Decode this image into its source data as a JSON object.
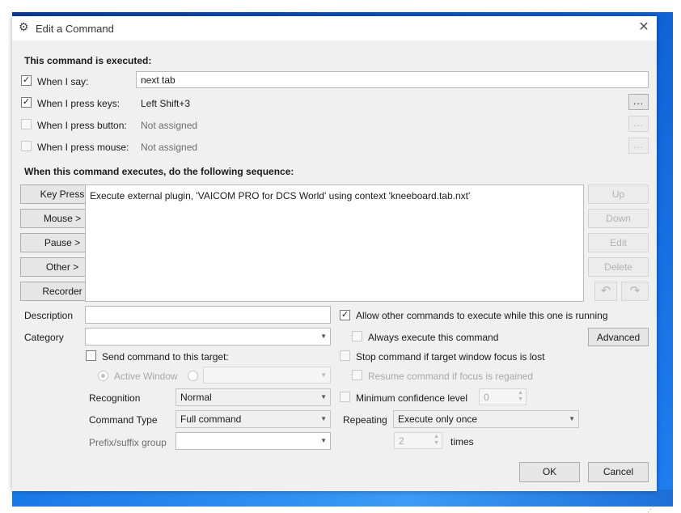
{
  "window": {
    "title": "Edit a Command",
    "icon": "gear-icon",
    "close_glyph": "✕"
  },
  "triggers": {
    "heading": "This command is executed:",
    "when_i_say": {
      "label": "When I say:",
      "checked": true,
      "value": "next tab"
    },
    "when_i_press_keys": {
      "label": "When I press keys:",
      "checked": true,
      "value": "Left Shift+3",
      "button": "..."
    },
    "when_i_press_button": {
      "label": "When I press button:",
      "checked": false,
      "value": "Not assigned",
      "button": "..."
    },
    "when_i_press_mouse": {
      "label": "When I press mouse:",
      "checked": false,
      "value": "Not assigned",
      "button": "..."
    }
  },
  "sequence": {
    "heading": "When this command executes, do the following sequence:",
    "left_buttons": [
      "Key Press",
      "Mouse >",
      "Pause >",
      "Other >",
      "Recorder"
    ],
    "items": [
      "Execute external plugin, 'VAICOM PRO for DCS World' using context 'kneeboard.tab.nxt'"
    ],
    "right_buttons": [
      "Up",
      "Down",
      "Edit",
      "Delete"
    ],
    "undo_icon": "undo-icon",
    "redo_icon": "redo-icon"
  },
  "options": {
    "description_label": "Description",
    "description_value": "",
    "category_label": "Category",
    "category_value": "",
    "send_to_target_label": "Send command to this target:",
    "active_window_label": "Active Window",
    "target_value": "",
    "recognition_label": "Recognition",
    "recognition_value": "Normal",
    "command_type_label": "Command Type",
    "command_type_value": "Full command",
    "prefix_suffix_label": "Prefix/suffix group",
    "prefix_suffix_value": "",
    "allow_other_label": "Allow other commands to execute while this one is running",
    "allow_other_checked": true,
    "always_execute_label": "Always execute this command",
    "advanced_button": "Advanced",
    "stop_focus_label": "Stop command if target window focus is lost",
    "resume_focus_label": "Resume command if focus is regained",
    "min_confidence_label": "Minimum confidence level",
    "min_confidence_value": "0",
    "repeating_label": "Repeating",
    "repeating_value": "Execute only once",
    "times_value": "2",
    "times_label": "times"
  },
  "footer": {
    "ok": "OK",
    "cancel": "Cancel"
  }
}
